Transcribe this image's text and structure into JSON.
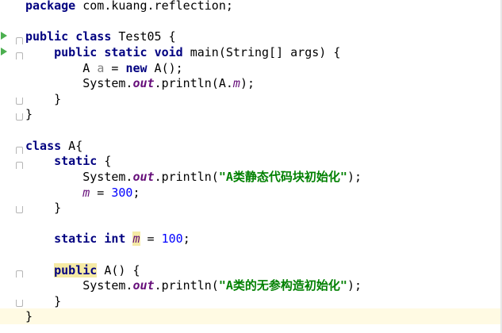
{
  "editor": {
    "lines": {
      "l1": {
        "kw1": "package",
        "rest": " com.kuang.reflection;"
      },
      "l3": {
        "kw1": "public",
        "kw2": "class",
        "rest": " Test05 {"
      },
      "l4": {
        "indent": "    ",
        "kw1": "public",
        "kw2": "static",
        "kw3": "void",
        "rest": " main(String[] args) {"
      },
      "l5": {
        "indent": "        ",
        "t1": "A ",
        "var": "a",
        "t2": " = ",
        "kw1": "new",
        "t3": " A();"
      },
      "l6": {
        "indent": "        ",
        "t1": "System.",
        "field": "out",
        "t2": ".println(A.",
        "field2": "m",
        "t3": ");"
      },
      "l7": {
        "indent": "    ",
        "t1": "}"
      },
      "l8": {
        "t1": "}"
      },
      "l10": {
        "kw1": "class",
        "rest": " A{"
      },
      "l11": {
        "indent": "    ",
        "kw1": "static",
        "rest": " {"
      },
      "l12": {
        "indent": "        ",
        "t1": "System.",
        "field": "out",
        "t2": ".println(",
        "str": "\"A类静态代码块初始化\"",
        "t3": ");"
      },
      "l13": {
        "indent": "        ",
        "field": "m",
        "t1": " = ",
        "num": "300",
        "t2": ";"
      },
      "l14": {
        "indent": "    ",
        "t1": "}"
      },
      "l16": {
        "indent": "    ",
        "kw1": "static",
        "kw2": "int",
        "field": "m",
        "t1": " = ",
        "num": "100",
        "t2": ";"
      },
      "l18": {
        "indent": "    ",
        "kw1": "public",
        "rest": " A() {"
      },
      "l19": {
        "indent": "        ",
        "t1": "System.",
        "field": "out",
        "t2": ".println(",
        "str": "\"A类的无参构造初始化\"",
        "t3": ");"
      },
      "l20": {
        "indent": "    ",
        "t1": "}"
      },
      "l21": {
        "t1": "}"
      }
    },
    "colors": {
      "keyword": "#000080",
      "string": "#008000",
      "field": "#660e7a",
      "number": "#0000ff",
      "current_line": "#fffae3",
      "run_arrow": "#4caf50"
    },
    "icons": [
      "run-arrow-icon",
      "fold-open-icon",
      "fold-close-icon"
    ]
  }
}
